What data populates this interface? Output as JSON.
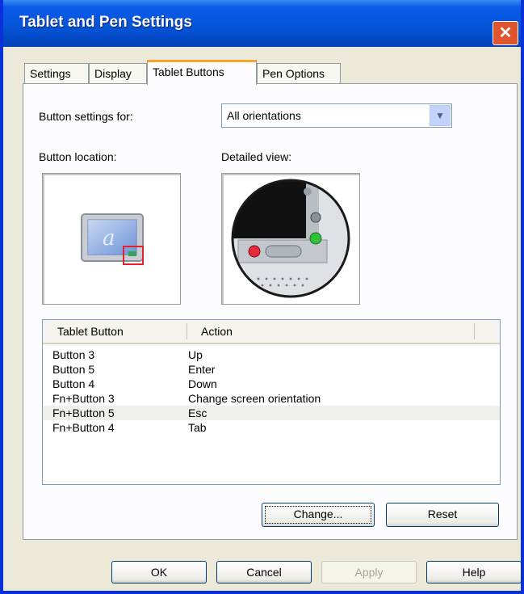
{
  "window": {
    "title": "Tablet and Pen Settings",
    "close_glyph": "✕"
  },
  "tabs": [
    {
      "label": "Settings"
    },
    {
      "label": "Display"
    },
    {
      "label": "Tablet Buttons"
    },
    {
      "label": "Pen Options"
    }
  ],
  "active_tab": "Tablet Buttons",
  "button_settings": {
    "label": "Button settings for:",
    "selected": "All orientations",
    "arrow_glyph": "▼"
  },
  "button_location": {
    "label": "Button location:",
    "tablet_glyph": "a"
  },
  "detailed_view": {
    "label": "Detailed view:"
  },
  "table": {
    "columns": [
      "Tablet Button",
      "Action"
    ],
    "rows": [
      {
        "button": "Button 3",
        "action": "Up"
      },
      {
        "button": "Button 5",
        "action": "Enter"
      },
      {
        "button": "Button 4",
        "action": "Down"
      },
      {
        "button": "Fn+Button 3",
        "action": "Change screen orientation"
      },
      {
        "button": "Fn+Button 5",
        "action": "Esc"
      },
      {
        "button": "Fn+Button 4",
        "action": "Tab"
      }
    ],
    "selected_row": "Fn+Button 5"
  },
  "panel_buttons": {
    "change": "Change...",
    "reset": "Reset"
  },
  "dialog_buttons": {
    "ok": "OK",
    "cancel": "Cancel",
    "apply": "Apply",
    "help": "Help"
  },
  "colors": {
    "titlebar": "#0453d6",
    "close": "#e0542e",
    "active_tab_accent": "#f7a527",
    "dialog_bg": "#ece9d8"
  }
}
